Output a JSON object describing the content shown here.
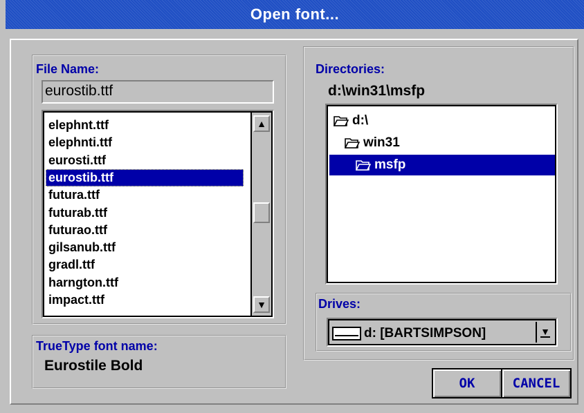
{
  "window": {
    "title": "Open font..."
  },
  "file_name": {
    "label": "File Name:",
    "value": "eurostib.ttf"
  },
  "file_list": {
    "items": [
      "elephnt.ttf",
      "elephnti.ttf",
      "eurosti.ttf",
      "eurostib.ttf",
      "futura.ttf",
      "futurab.ttf",
      "futurao.ttf",
      "gilsanub.ttf",
      "gradl.ttf",
      "harngton.ttf",
      "impact.ttf"
    ],
    "selected_index": 3,
    "scroll_position": 0.5
  },
  "truetype": {
    "label": "TrueType font name:",
    "value": "Eurostile Bold"
  },
  "directories": {
    "label": "Directories:",
    "current_path": "d:\\win31\\msfp",
    "tree": [
      {
        "name": "d:\\",
        "icon": "folder-open-icon"
      },
      {
        "name": "win31",
        "icon": "folder-open-icon"
      },
      {
        "name": "msfp",
        "icon": "folder-open-icon",
        "selected": true
      }
    ]
  },
  "drives": {
    "label": "Drives:",
    "value": "d: [BARTSIMPSON]",
    "icon": "drive-icon"
  },
  "buttons": {
    "ok": "OK",
    "cancel": "CANCEL"
  },
  "colors": {
    "titlebar": "#1f4fc4",
    "selection": "#0000a8",
    "face": "#c0c0c0",
    "label": "#0000a8"
  }
}
